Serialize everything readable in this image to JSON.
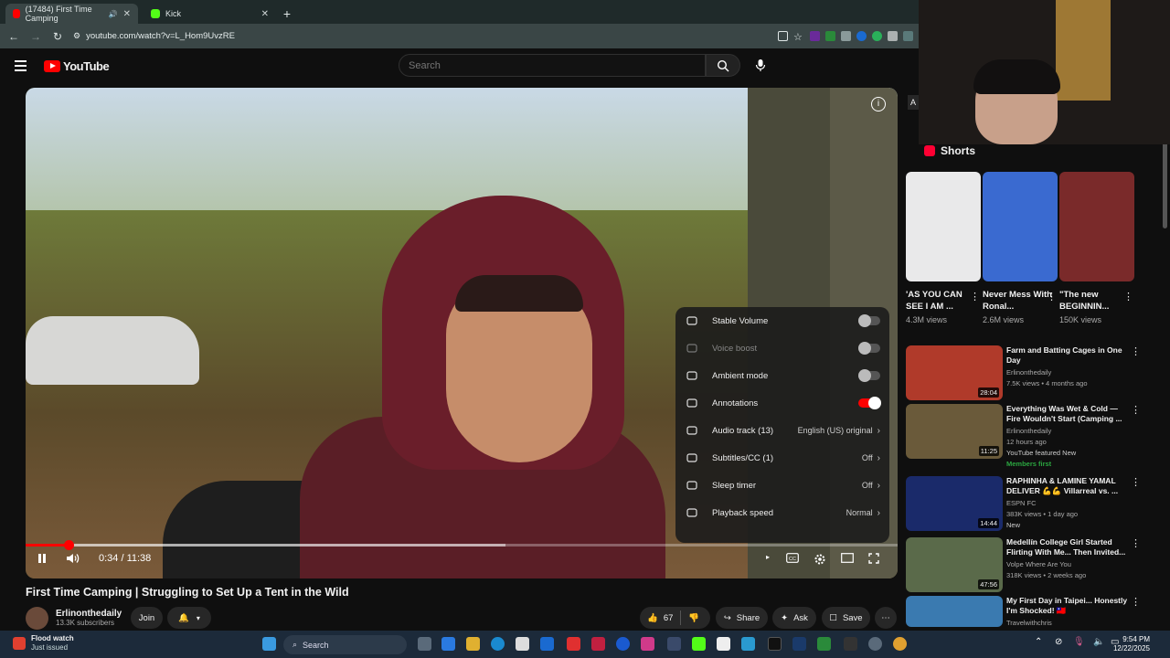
{
  "browser": {
    "tabs": [
      {
        "title": "(17484) First Time Camping",
        "active": true
      },
      {
        "title": "Kick",
        "active": false
      }
    ],
    "url": "youtube.com/watch?v=L_Hom9UvzRE"
  },
  "youtube": {
    "logo_text": "YouTube",
    "search_placeholder": "Search"
  },
  "player": {
    "time": "0:34 / 11:38",
    "progress_fraction": 0.049,
    "buffered_fraction": 0.55
  },
  "settings_menu": [
    {
      "label": "Stable Volume",
      "icon": "stable-volume-icon",
      "type": "toggle",
      "on": false,
      "dim": false
    },
    {
      "label": "Voice boost",
      "icon": "voice-boost-icon",
      "type": "toggle",
      "on": false,
      "dim": true
    },
    {
      "label": "Ambient mode",
      "icon": "ambient-mode-icon",
      "type": "toggle",
      "on": false,
      "dim": false
    },
    {
      "label": "Annotations",
      "icon": "annotations-icon",
      "type": "toggle",
      "on": true,
      "dim": false
    },
    {
      "label": "Audio track (13)",
      "icon": "audio-track-icon",
      "type": "value",
      "value": "English (US) original"
    },
    {
      "label": "Subtitles/CC (1)",
      "icon": "subtitles-icon",
      "type": "value",
      "value": "Off"
    },
    {
      "label": "Sleep timer",
      "icon": "sleep-timer-icon",
      "type": "value",
      "value": "Off"
    },
    {
      "label": "Playback speed",
      "icon": "playback-speed-icon",
      "type": "value",
      "value": "Normal"
    }
  ],
  "video": {
    "title": "First Time Camping | Struggling to Set Up a Tent in the Wild",
    "channel": "Erlinonthedaily",
    "subscribers": "13.3K subscribers",
    "join": "Join",
    "likes": "67",
    "share": "Share",
    "ask": "Ask",
    "save": "Save"
  },
  "sidebar": {
    "shorts_title": "Shorts",
    "shorts": [
      {
        "title": "'AS YOU CAN SEE I AM ...",
        "views": "4.3M views",
        "color": "#e9e9ea"
      },
      {
        "title": "Never Mess With Ronal...",
        "views": "2.6M views",
        "color": "#3a6ad0"
      },
      {
        "title": "\"The new BEGINNIN...",
        "views": "150K views",
        "color": "#7a2a2a"
      }
    ],
    "videos": [
      {
        "title": "Farm and Batting Cages in One Day",
        "channel": "Erlinonthedaily",
        "meta": "7.5K views • 4 months ago",
        "extra": "",
        "duration": "28:04",
        "color": "#b03a2a"
      },
      {
        "title": "Everything Was Wet & Cold — Fire Wouldn't Start (Camping ...",
        "channel": "Erlinonthedaily",
        "meta": "12 hours ago",
        "extra": "YouTube featured   New",
        "badge": "Members first",
        "duration": "11:25",
        "color": "#6a5a3a"
      },
      {
        "title": "RAPHINHA & LAMINE YAMAL DELIVER 💪💪 Villarreal vs. ...",
        "channel": "ESPN FC",
        "meta": "383K views • 1 day ago",
        "extra": "New",
        "duration": "14:44",
        "color": "#1a2a6a"
      },
      {
        "title": "Medellín College Girl Started Flirting With Me... Then Invited...",
        "channel": "Volpe Where Are You",
        "meta": "318K views • 2 weeks ago",
        "extra": "",
        "duration": "47:56",
        "color": "#5a6a4a"
      },
      {
        "title": "My First Day in Taipei... Honestly I'm Shocked! 🇹🇼",
        "channel": "Travelwithchris",
        "meta": "",
        "extra": "",
        "duration": "",
        "color": "#3a7ab0"
      }
    ]
  },
  "taskbar": {
    "weather_title": "Flood watch",
    "weather_sub": "Just issued",
    "search": "Search",
    "time": "9:54 PM",
    "date": "12/22/2025"
  }
}
